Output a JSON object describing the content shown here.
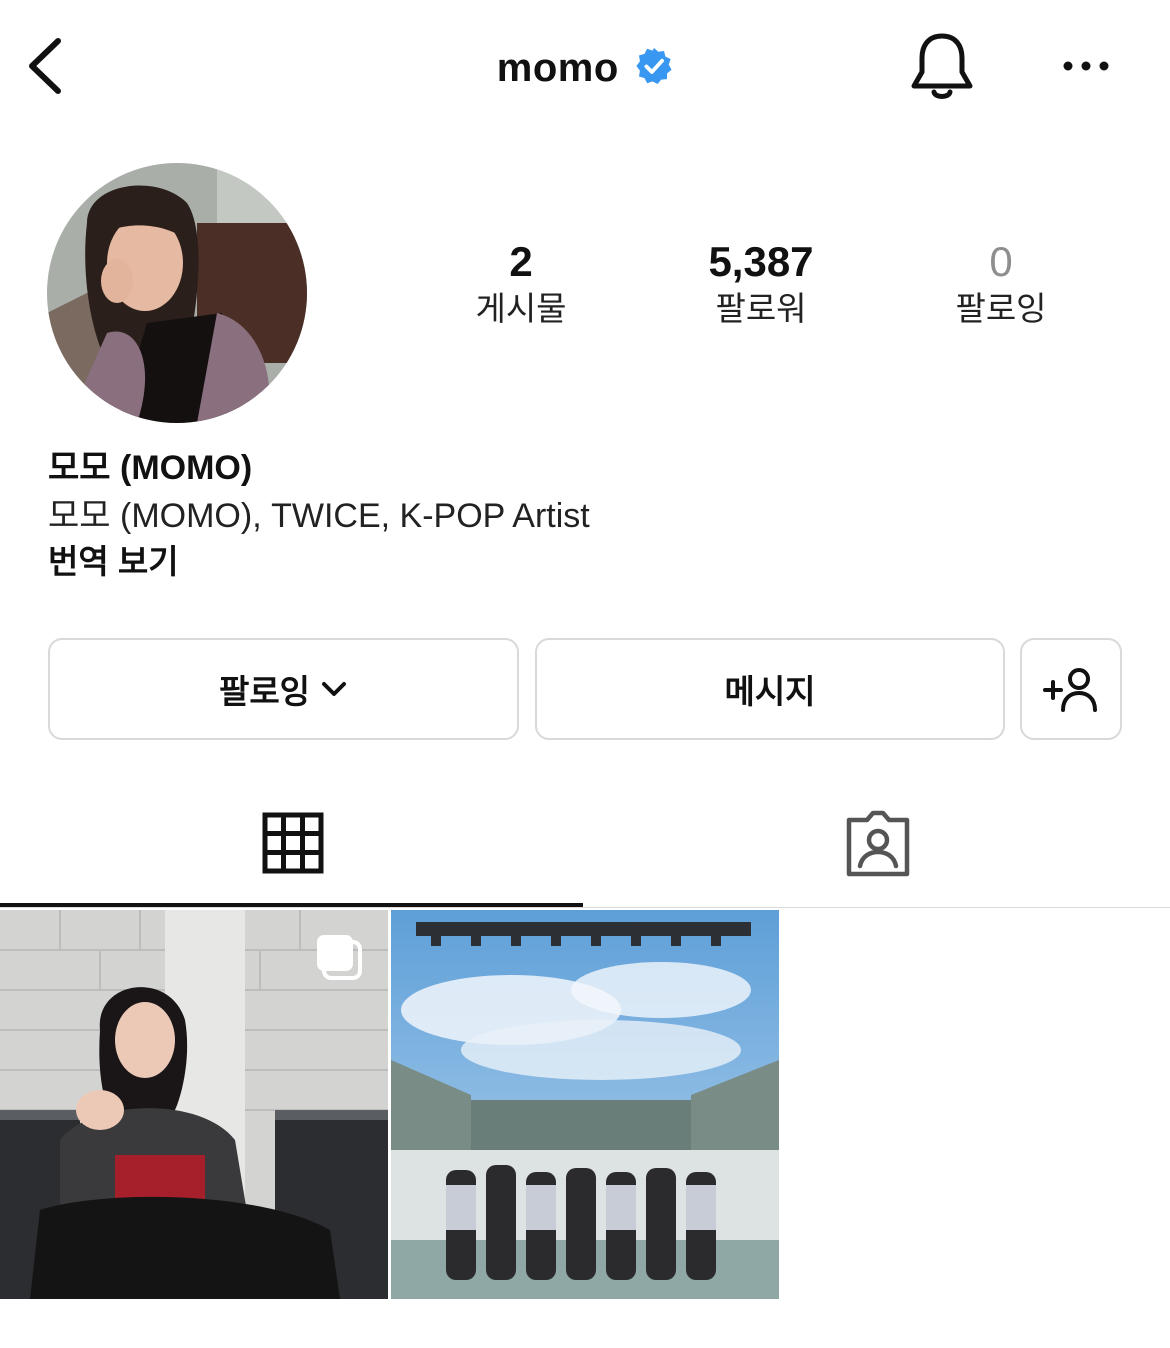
{
  "header": {
    "username": "momo",
    "icons": {
      "back": "chevron-left-icon",
      "verified": "verified-badge-icon",
      "notifications": "bell-icon",
      "more": "more-options-icon"
    }
  },
  "stats": [
    {
      "value": "2",
      "label": "게시물"
    },
    {
      "value": "5,387",
      "label": "팔로워"
    },
    {
      "value": "0",
      "label": "팔로잉"
    }
  ],
  "bio": {
    "name": "모모 (MOMO)",
    "description": "모모 (MOMO), TWICE, K-POP Artist",
    "translate_label": "번역 보기"
  },
  "actions": {
    "following_label": "팔로잉",
    "message_label": "메시지",
    "add_user_icon": "add-person-icon"
  },
  "tabs": [
    {
      "name": "posts-grid",
      "icon": "grid-icon",
      "active": true
    },
    {
      "name": "tagged",
      "icon": "tagged-person-icon",
      "active": false
    }
  ],
  "posts": [
    {
      "type": "carousel",
      "icon": "multiple-photos-icon"
    },
    {
      "type": "photo"
    }
  ],
  "colors": {
    "verified": "#3897f0",
    "border": "#dbdbdb",
    "text": "#111111",
    "muted": "#8e8e8e"
  }
}
